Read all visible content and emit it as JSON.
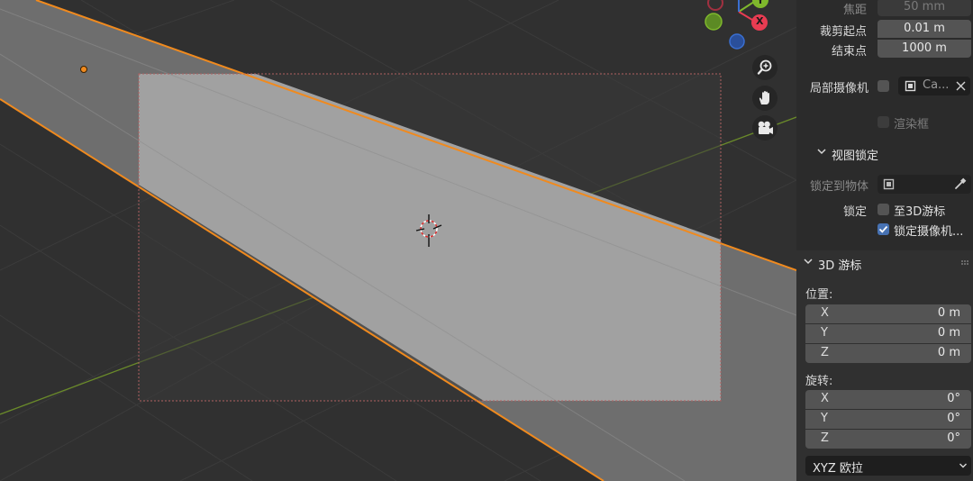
{
  "camera_panel": {
    "focal_length": {
      "label": "焦距",
      "value": "50 mm"
    },
    "clip_start": {
      "label": "裁剪起点",
      "value": "0.01 m"
    },
    "clip_end": {
      "label": "结束点",
      "value": "1000 m"
    },
    "local_camera": {
      "label": "局部摄像机",
      "object_value": "Ca..."
    },
    "render_region": {
      "label": "渲染框",
      "checked": false
    }
  },
  "view_lock": {
    "header": "视图锁定",
    "lock_to_object": {
      "label": "锁定到物体"
    },
    "lock": {
      "label": "锁定",
      "to_3d_cursor": {
        "label": "至3D游标",
        "checked": false
      },
      "camera_to_view": {
        "label": "锁定摄像机...",
        "checked": true
      }
    }
  },
  "cursor_3d": {
    "header": "3D 游标",
    "location": {
      "label": "位置:",
      "rows": [
        {
          "axis": "X",
          "value": "0 m"
        },
        {
          "axis": "Y",
          "value": "0 m"
        },
        {
          "axis": "Z",
          "value": "0 m"
        }
      ]
    },
    "rotation": {
      "label": "旋转:",
      "rows": [
        {
          "axis": "X",
          "value": "0°"
        },
        {
          "axis": "Y",
          "value": "0°"
        },
        {
          "axis": "Z",
          "value": "0°"
        }
      ]
    },
    "rotation_mode": "XYZ 欧拉"
  },
  "gizmo": {
    "x_label": "X",
    "y_label": "Y"
  },
  "icons": [
    "zoom-icon",
    "hand-pan-icon",
    "camera-view-icon",
    "eyedropper-icon",
    "object-picker-icon",
    "clear-x-icon",
    "chevron-down-icon",
    "drag-grip-icon",
    "crosshair-3d-cursor-icon"
  ],
  "colors": {
    "selection_orange": "#f08a1e",
    "axis_x": "#e83c52",
    "axis_y": "#7fb82c",
    "axis_z": "#3a6fd1",
    "checkbox_on": "#4772b3",
    "panel_bg": "#2b2b2b"
  }
}
